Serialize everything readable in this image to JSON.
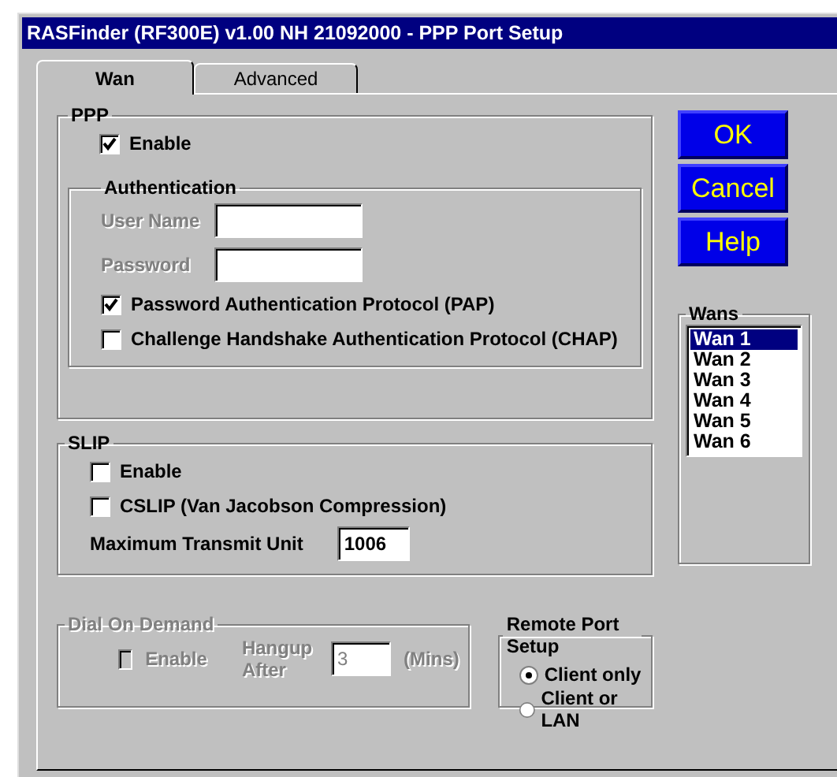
{
  "window": {
    "title": "RASFinder (RF300E) v1.00 NH 21092000  - PPP Port Setup"
  },
  "tabs": [
    {
      "label": "Wan",
      "selected": true
    },
    {
      "label": "Advanced",
      "selected": false
    }
  ],
  "ppp": {
    "title": "PPP",
    "enable": {
      "label": "Enable",
      "checked": true
    },
    "authentication": {
      "title": "Authentication",
      "fields": [
        {
          "label": "User Name",
          "disabled": true
        },
        {
          "label": "Password",
          "disabled": true
        }
      ],
      "options": [
        {
          "label": "Password Authentication Protocol (PAP)",
          "checked": true
        },
        {
          "label": "Challenge Handshake Authentication Protocol (CHAP)",
          "checked": false
        }
      ]
    }
  },
  "slip": {
    "title": "SLIP",
    "options": [
      {
        "label": "Enable",
        "checked": false
      },
      {
        "label": "CSLIP (Van Jacobson Compression)",
        "checked": false
      }
    ],
    "mtu": {
      "label": "Maximum Transmit Unit",
      "value": "1006"
    }
  },
  "dial_on_demand": {
    "title": "Dial On Demand",
    "disabled": true,
    "enable": {
      "label": "Enable",
      "checked": false
    },
    "hangup_label": "Hangup After",
    "hangup_value": "3",
    "unit": "(Mins)"
  },
  "remote_port_setup": {
    "title": "Remote Port Setup",
    "options": [
      {
        "label": "Client only",
        "selected": true
      },
      {
        "label": "Client or LAN",
        "selected": false
      }
    ]
  },
  "buttons": [
    "OK",
    "Cancel",
    "Help"
  ],
  "wans": {
    "title": "Wans",
    "items": [
      {
        "label": "Wan 1",
        "selected": true
      },
      {
        "label": "Wan 2",
        "selected": false
      },
      {
        "label": "Wan 3",
        "selected": false
      },
      {
        "label": "Wan 4",
        "selected": false
      },
      {
        "label": "Wan 5",
        "selected": false
      },
      {
        "label": "Wan 6",
        "selected": false
      }
    ]
  }
}
